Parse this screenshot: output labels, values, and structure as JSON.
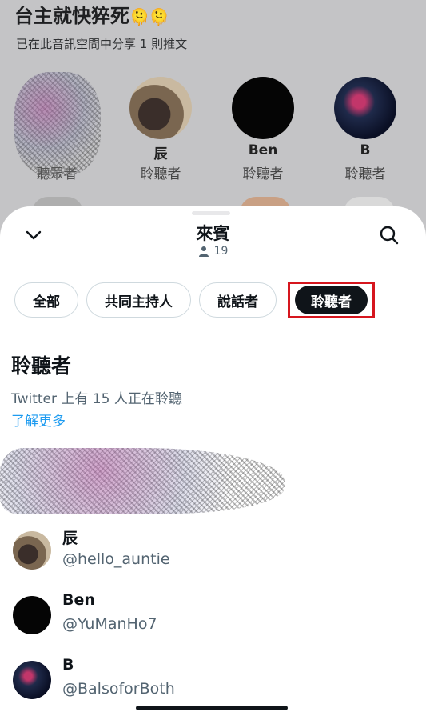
{
  "space": {
    "title": "台主就快猝死",
    "emojis": "🫠🫠",
    "subtitle": "已在此音訊空間中分享 1 則推文",
    "speakers": [
      {
        "name": "",
        "role": "聽眾者"
      },
      {
        "name": "辰",
        "role": "聆聽者"
      },
      {
        "name": "Ben",
        "role": "聆聽者"
      },
      {
        "name": "B",
        "role": "聆聽者"
      }
    ]
  },
  "sheet": {
    "title": "來賓",
    "count": "19",
    "icons": {
      "collapse": "chevron-down-icon",
      "search": "search-icon",
      "count": "person-icon"
    },
    "tabs": [
      {
        "label": "全部",
        "active": false
      },
      {
        "label": "共同主持人",
        "active": false
      },
      {
        "label": "說話者",
        "active": false
      },
      {
        "label": "聆聽者",
        "active": true
      }
    ],
    "highlight_color": "#d6161e",
    "section": {
      "title": "聆聽者",
      "description": "Twitter 上有 15 人正在聆聽",
      "learn_more": "了解更多"
    },
    "listeners": [
      {
        "name": "辰",
        "handle": "@hello_auntie"
      },
      {
        "name": "Ben",
        "handle": "@YuManHo7"
      },
      {
        "name": "B",
        "handle": "@BalsoforBoth"
      }
    ]
  }
}
